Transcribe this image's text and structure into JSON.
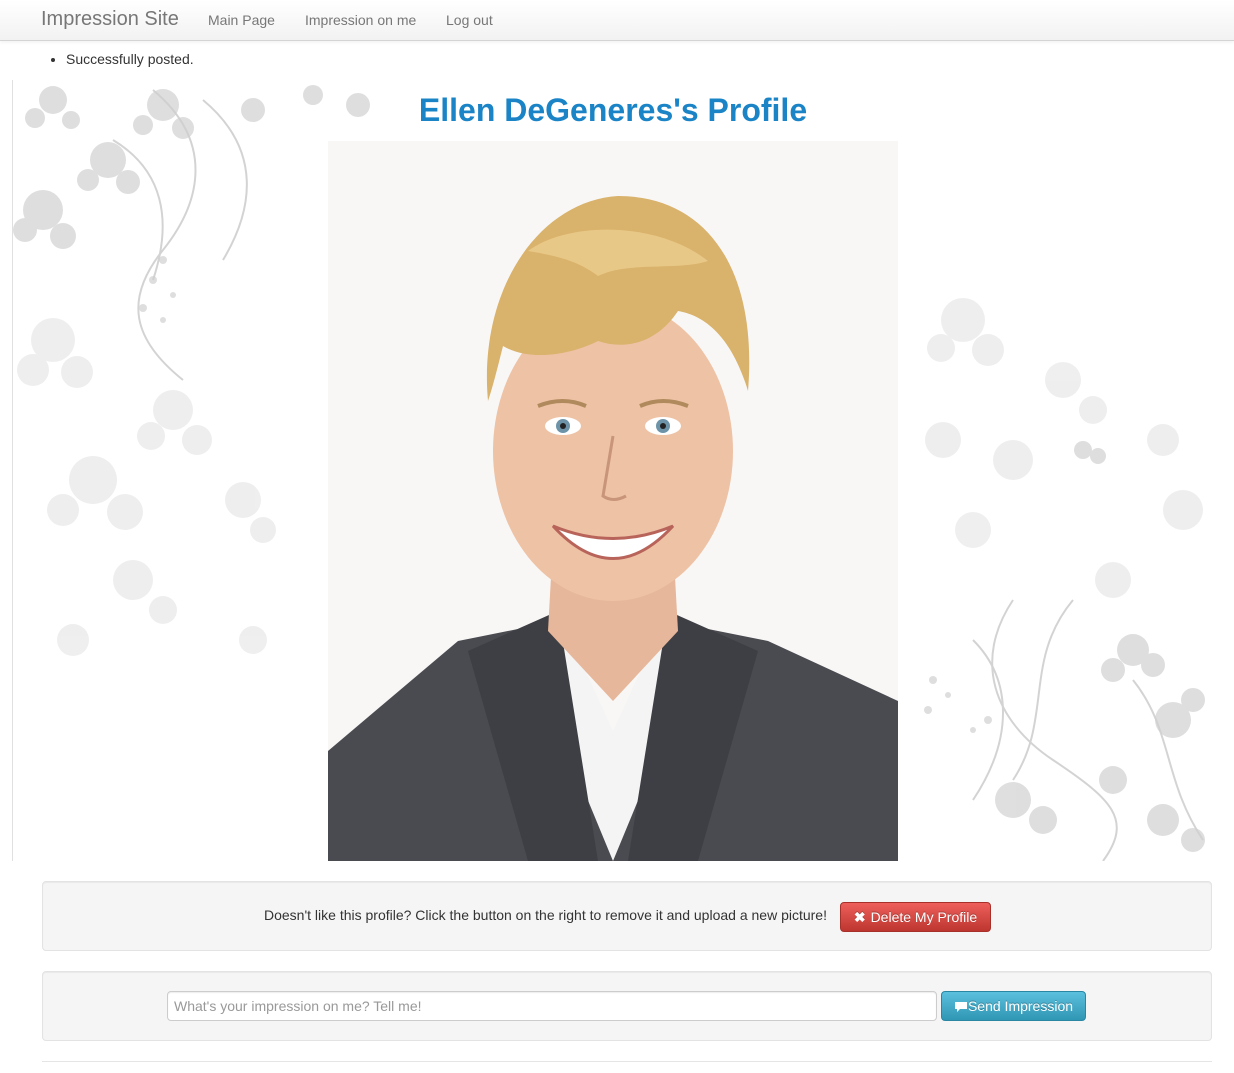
{
  "navbar": {
    "brand": "Impression Site",
    "links": [
      "Main Page",
      "Impression on me",
      "Log out"
    ]
  },
  "flash": {
    "message": "Successfully posted."
  },
  "profile": {
    "title": "Ellen DeGeneres's Profile",
    "photo_icon": "profile-portrait",
    "title_color": "#1a84c6"
  },
  "delete_panel": {
    "text": "Doesn't like this profile? Click the button on the right to remove it and upload a new picture!",
    "button_label": "Delete My Profile",
    "button_icon": "x-icon",
    "button_color": "#da4f49"
  },
  "impression_form": {
    "placeholder": "What's your impression on me? Tell me!",
    "value": "",
    "button_label": "Send Impression",
    "button_icon": "comment-icon",
    "button_color": "#49afcd"
  }
}
